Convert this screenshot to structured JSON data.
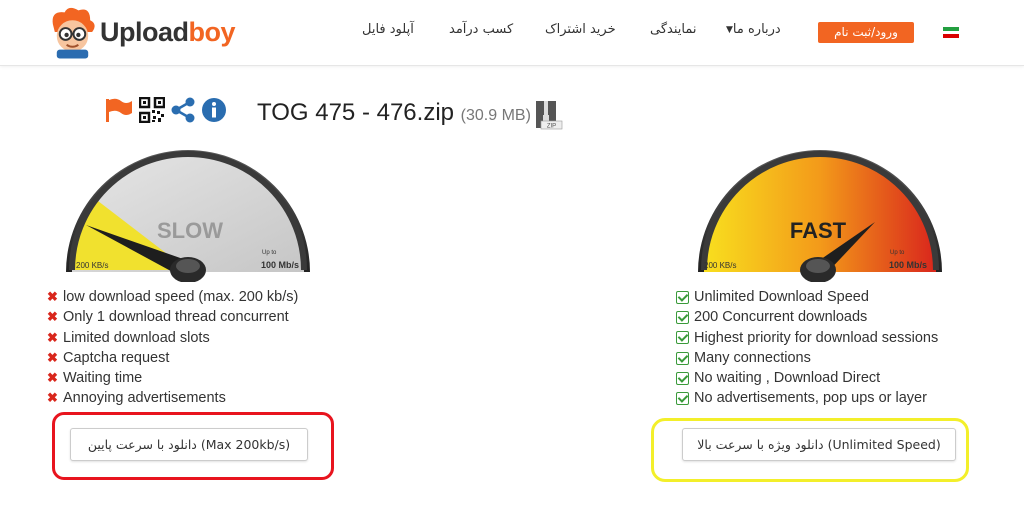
{
  "brand": {
    "name_part1": "Upload",
    "name_part2": "boy"
  },
  "nav": {
    "upload": "آپلود فایل",
    "earn": "کسب درآمد",
    "buy": "خرید اشتراک",
    "agent": "نمایندگی",
    "about": "درباره ما",
    "login": "ورود/ثبت نام"
  },
  "file": {
    "name": "TOG 475 - 476.zip",
    "size": "(30.9 MB)",
    "zip_label": "ZIP"
  },
  "gauges": {
    "slow": {
      "label": "SLOW",
      "min_label": "200 KB/s",
      "max_prefix": "Up to",
      "max_label": "100 Mb/s"
    },
    "fast": {
      "label": "FAST",
      "min_label": "200 KB/s",
      "max_prefix": "Up to",
      "max_label": "100 Mb/s"
    }
  },
  "slow_features": [
    "low download speed (max. 200 kb/s)",
    "Only 1 download thread concurrent",
    "Limited download slots",
    "Captcha request",
    "Waiting time",
    "Annoying advertisements"
  ],
  "fast_features": [
    "Unlimited Download Speed",
    "200 Concurrent downloads",
    "Highest priority for download sessions",
    "Many connections",
    "No waiting , Download Direct",
    "No advertisements, pop ups or layer"
  ],
  "buttons": {
    "slow": "دانلود با سرعت پایین (Max 200kb/s)",
    "fast": "دانلود ویژه با سرعت بالا (Unlimited Speed)"
  },
  "colors": {
    "accent": "#f26522",
    "highlight_red": "#e8141e",
    "highlight_yellow": "#f3ef2a",
    "check_green": "#3a9a3a",
    "cross_red": "#d9261c"
  },
  "icons": [
    "flag-icon",
    "qr-code-icon",
    "share-icon",
    "info-icon",
    "zip-file-icon",
    "iran-flag-icon"
  ]
}
